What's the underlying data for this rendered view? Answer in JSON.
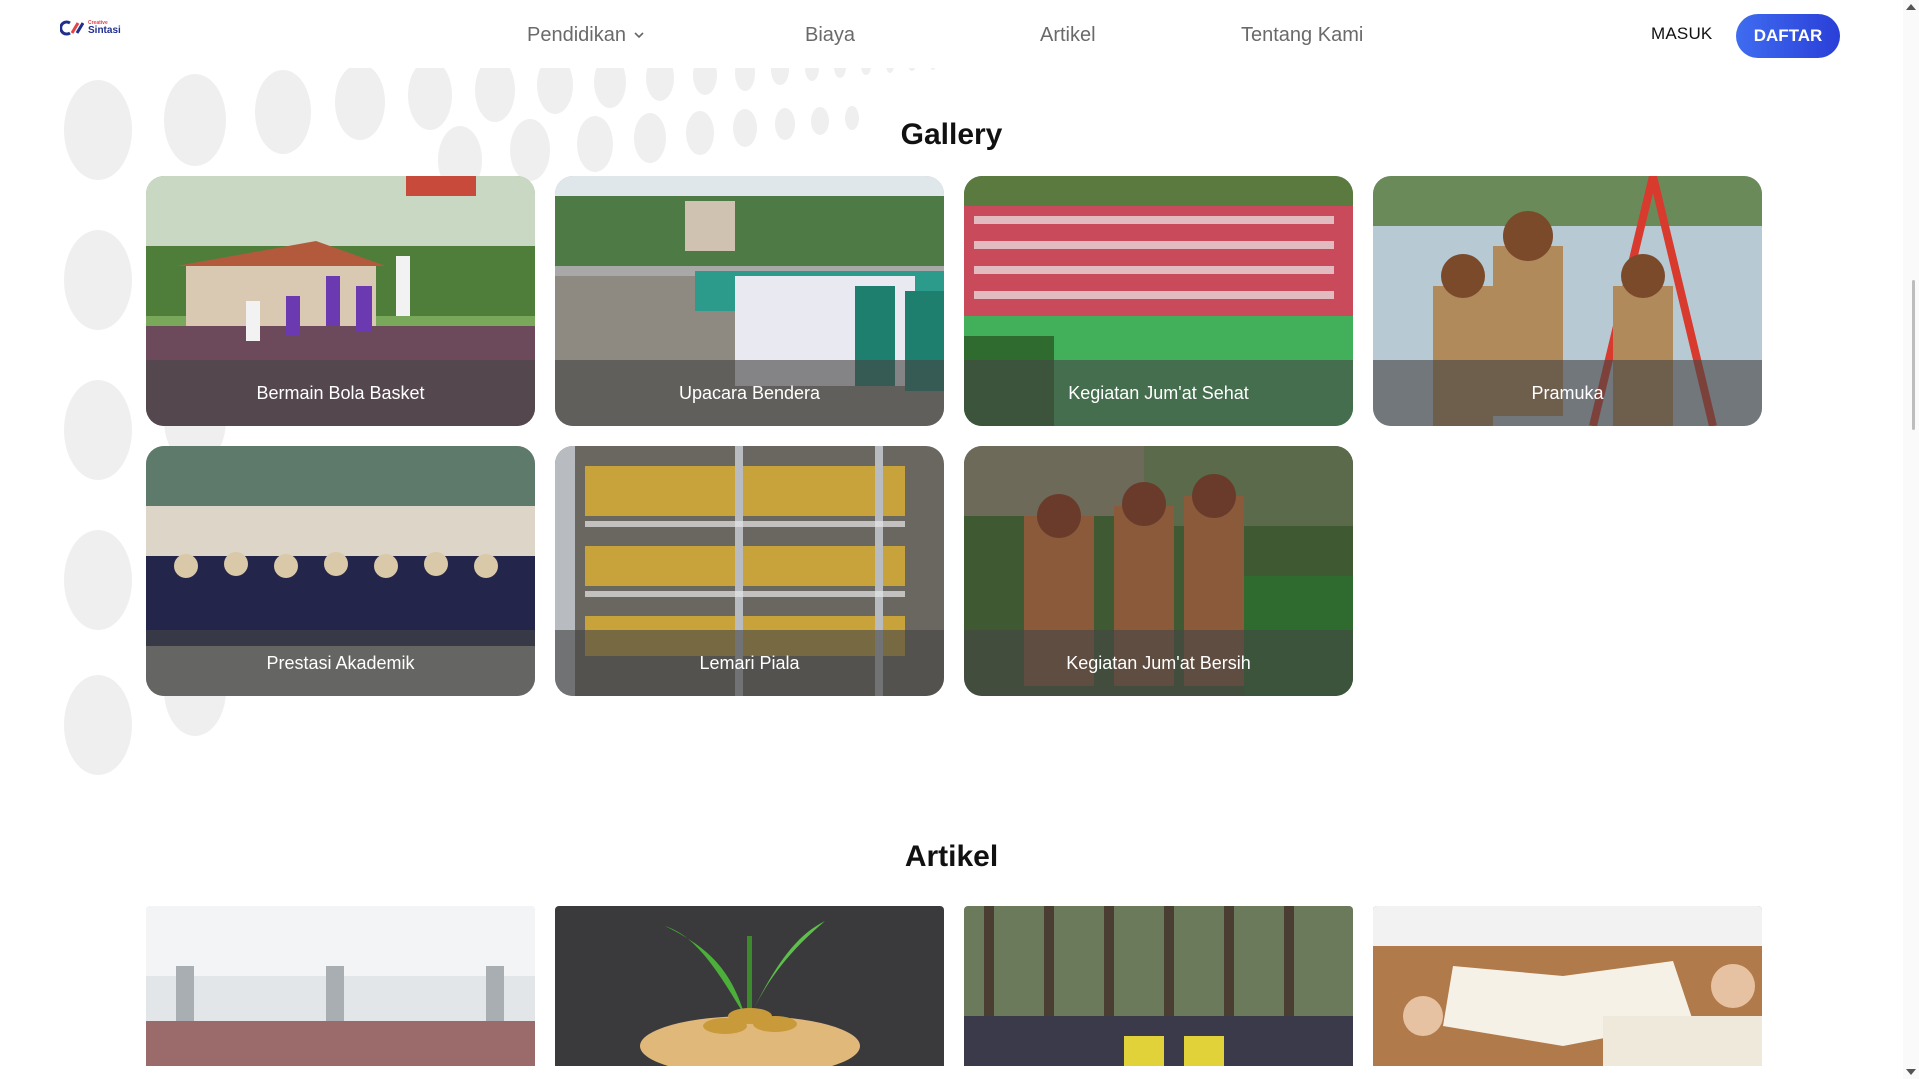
{
  "brand": {
    "small": "Creative",
    "name": "Sintasi"
  },
  "nav": {
    "pendidikan": "Pendidikan",
    "biaya": "Biaya",
    "artikel": "Artikel",
    "tentang": "Tentang Kami",
    "masuk": "MASUK",
    "daftar": "DAFTAR"
  },
  "gallery": {
    "title": "Gallery",
    "items": [
      {
        "caption": "Bermain Bola Basket"
      },
      {
        "caption": "Upacara Bendera"
      },
      {
        "caption": "Kegiatan Jum'at Sehat"
      },
      {
        "caption": "Pramuka"
      },
      {
        "caption": "Prestasi Akademik"
      },
      {
        "caption": "Lemari Piala"
      },
      {
        "caption": "Kegiatan Jum'at Bersih"
      }
    ]
  },
  "artikel": {
    "title": "Artikel"
  },
  "colors": {
    "primary": "#2f4ee0",
    "caption_bg": "#464646",
    "dots": "#ececec"
  }
}
